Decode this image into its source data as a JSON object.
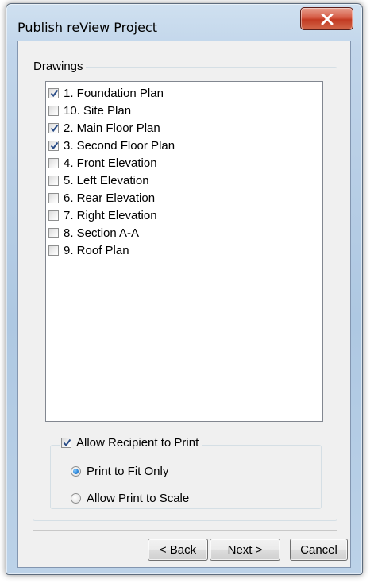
{
  "window": {
    "title": "Publish reView Project"
  },
  "drawings_group": {
    "label": "Drawings",
    "items": [
      {
        "label": "1. Foundation Plan",
        "checked": true
      },
      {
        "label": "10. Site Plan",
        "checked": false
      },
      {
        "label": "2. Main Floor Plan",
        "checked": true
      },
      {
        "label": "3. Second Floor Plan",
        "checked": true
      },
      {
        "label": "4. Front Elevation",
        "checked": false
      },
      {
        "label": "5. Left Elevation",
        "checked": false
      },
      {
        "label": "6. Rear Elevation",
        "checked": false
      },
      {
        "label": "7. Right Elevation",
        "checked": false
      },
      {
        "label": "8. Section A-A",
        "checked": false
      },
      {
        "label": "9. Roof Plan",
        "checked": false
      }
    ]
  },
  "print_group": {
    "allow_print_label": "Allow Recipient to Print",
    "allow_print_checked": true,
    "options": [
      {
        "label": "Print to Fit Only",
        "selected": true
      },
      {
        "label": "Allow Print to Scale",
        "selected": false
      }
    ]
  },
  "buttons": {
    "back": "< Back",
    "next": "Next >",
    "cancel": "Cancel"
  },
  "icons": {
    "close": "close-icon",
    "check": "checkmark-icon"
  },
  "colors": {
    "close_button": "#c8452c",
    "check_mark": "#2a4d87",
    "radio_dot": "#2b86d9"
  }
}
